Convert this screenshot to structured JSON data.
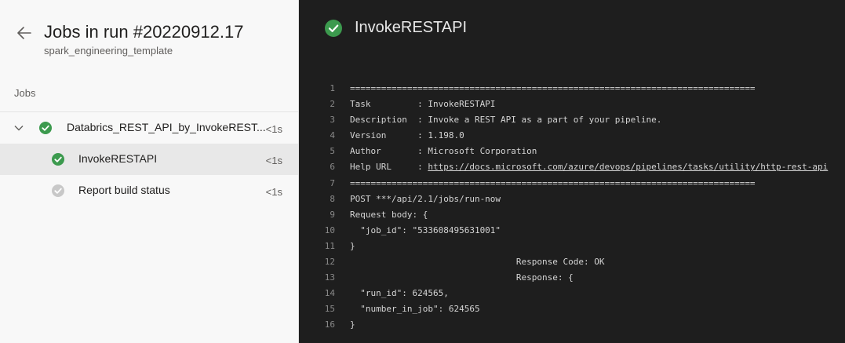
{
  "sidebar": {
    "title": "Jobs in run #20220912.17",
    "subtitle": "spark_engineering_template",
    "jobs_label": "Jobs",
    "parent_job": {
      "name": "Databrics_REST_API_by_InvokeREST...",
      "duration": "<1s"
    },
    "items": [
      {
        "name": "InvokeRESTAPI",
        "duration": "<1s",
        "status": "succeeded"
      },
      {
        "name": "Report build status",
        "duration": "<1s",
        "status": "pending"
      }
    ]
  },
  "log": {
    "title": "InvokeRESTAPI",
    "lines": [
      {
        "n": "1",
        "text": "=============================================================================="
      },
      {
        "n": "2",
        "text": "Task         : InvokeRESTAPI"
      },
      {
        "n": "3",
        "text": "Description  : Invoke a REST API as a part of your pipeline."
      },
      {
        "n": "4",
        "text": "Version      : 1.198.0"
      },
      {
        "n": "5",
        "text": "Author       : Microsoft Corporation"
      },
      {
        "n": "6",
        "text": "Help URL     : ",
        "link": "https://docs.microsoft.com/azure/devops/pipelines/tasks/utility/http-rest-api"
      },
      {
        "n": "7",
        "text": "=============================================================================="
      },
      {
        "n": "8",
        "text": "POST ***/api/2.1/jobs/run-now"
      },
      {
        "n": "9",
        "text": "Request body: {"
      },
      {
        "n": "10",
        "text": "  \"job_id\": \"533608495631001\""
      },
      {
        "n": "11",
        "text": "}"
      },
      {
        "n": "12",
        "text": "                                Response Code: OK"
      },
      {
        "n": "13",
        "text": "                                Response: {"
      },
      {
        "n": "14",
        "text": "  \"run_id\": 624565,"
      },
      {
        "n": "15",
        "text": "  \"number_in_job\": 624565"
      },
      {
        "n": "16",
        "text": "}"
      }
    ]
  },
  "colors": {
    "success": "#3c9a4e",
    "pending": "#c8c8c8"
  }
}
